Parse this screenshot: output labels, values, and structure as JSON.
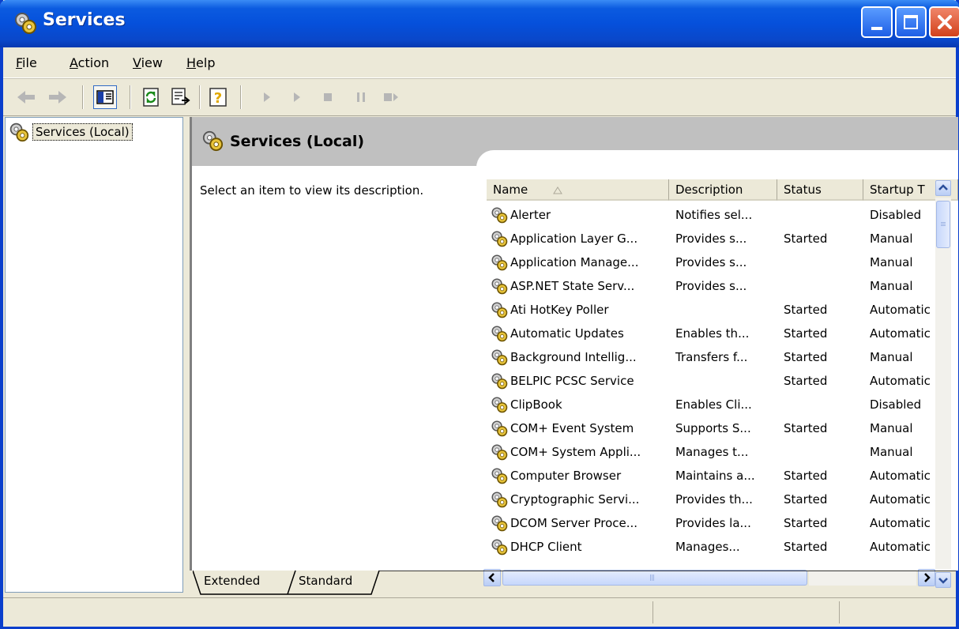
{
  "window": {
    "title": "Services"
  },
  "menu": {
    "file": "File",
    "action": "Action",
    "view": "View",
    "help": "Help"
  },
  "toolbar": {
    "buttons": [
      "back-icon",
      "forward-icon",
      "show-hide-console-tree-icon",
      "refresh-icon",
      "export-list-icon",
      "help-icon",
      "start-service-icon",
      "start-icon",
      "stop-service-icon",
      "pause-service-icon",
      "restart-service-icon"
    ]
  },
  "tree": {
    "root_label": "Services (Local)"
  },
  "details": {
    "header_title": "Services (Local)",
    "description_prompt": "Select an item to view its description."
  },
  "list": {
    "columns": [
      "Name",
      "Description",
      "Status",
      "Startup T"
    ],
    "rows": [
      {
        "name": "Alerter",
        "description": "Notifies sel...",
        "status": "",
        "startup": "Disabled"
      },
      {
        "name": "Application Layer G...",
        "description": "Provides s...",
        "status": "Started",
        "startup": "Manual"
      },
      {
        "name": "Application Manage...",
        "description": "Provides s...",
        "status": "",
        "startup": "Manual"
      },
      {
        "name": "ASP.NET State Serv...",
        "description": "Provides s...",
        "status": "",
        "startup": "Manual"
      },
      {
        "name": "Ati HotKey Poller",
        "description": "",
        "status": "Started",
        "startup": "Automatic"
      },
      {
        "name": "Automatic Updates",
        "description": "Enables th...",
        "status": "Started",
        "startup": "Automatic"
      },
      {
        "name": "Background Intellig...",
        "description": "Transfers f...",
        "status": "Started",
        "startup": "Manual"
      },
      {
        "name": "BELPIC PCSC Service",
        "description": "",
        "status": "Started",
        "startup": "Automatic"
      },
      {
        "name": "ClipBook",
        "description": "Enables Cli...",
        "status": "",
        "startup": "Disabled"
      },
      {
        "name": "COM+ Event System",
        "description": "Supports S...",
        "status": "Started",
        "startup": "Manual"
      },
      {
        "name": "COM+ System Appli...",
        "description": "Manages t...",
        "status": "",
        "startup": "Manual"
      },
      {
        "name": "Computer Browser",
        "description": "Maintains a...",
        "status": "Started",
        "startup": "Automatic"
      },
      {
        "name": "Cryptographic Servi...",
        "description": "Provides th...",
        "status": "Started",
        "startup": "Automatic"
      },
      {
        "name": "DCOM Server Proce...",
        "description": "Provides la...",
        "status": "Started",
        "startup": "Automatic"
      },
      {
        "name": "DHCP Client",
        "description": "Manages...",
        "status": "Started",
        "startup": "Automatic"
      }
    ]
  },
  "tabs": {
    "extended": "Extended",
    "standard": "Standard"
  },
  "colors": {
    "titlebar": "#0550db",
    "chrome": "#ece9d8",
    "header_band": "#c0c0c0"
  }
}
